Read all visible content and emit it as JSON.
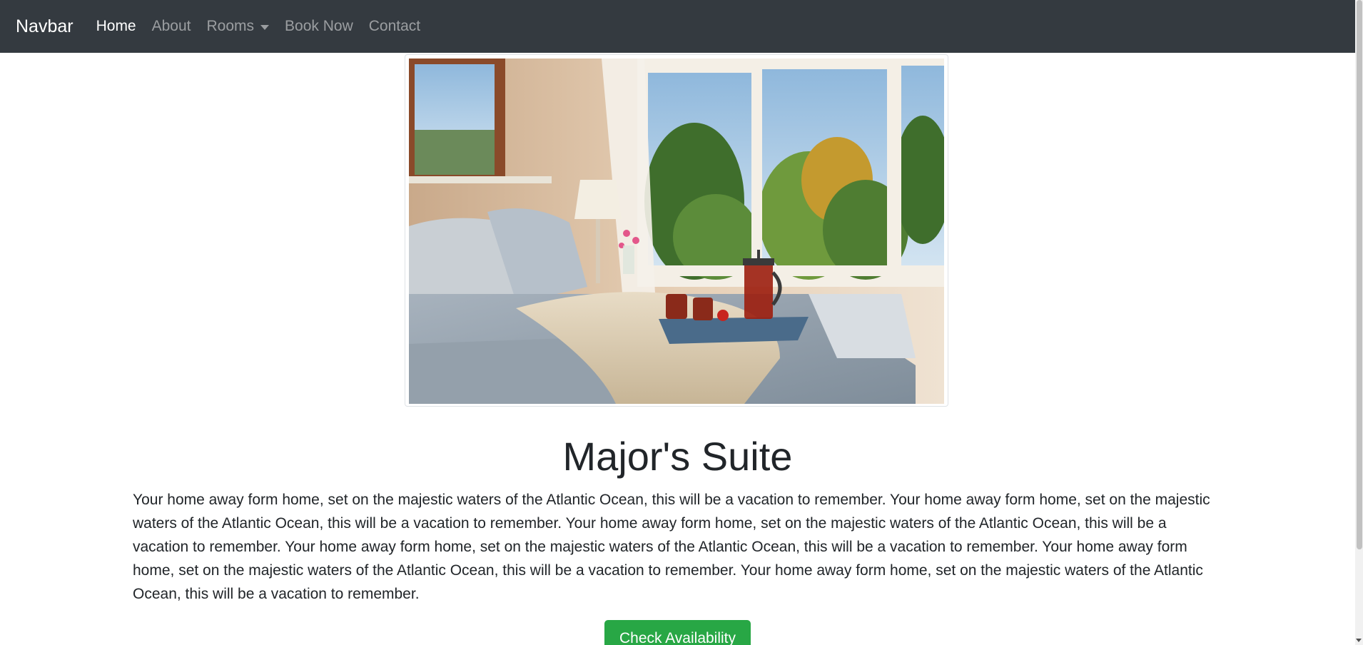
{
  "navbar": {
    "brand": "Navbar",
    "links": [
      {
        "label": "Home",
        "active": true
      },
      {
        "label": "About",
        "active": false
      },
      {
        "label": "Rooms",
        "active": false,
        "dropdown": true
      },
      {
        "label": "Book Now",
        "active": false
      },
      {
        "label": "Contact",
        "active": false
      }
    ]
  },
  "hero": {
    "image_icon": "bedroom-photo"
  },
  "room": {
    "title": "Major's Suite",
    "description": "Your home away form home, set on the majestic waters of the Atlantic Ocean, this will be a vacation to remember. Your home away form home, set on the majestic waters of the Atlantic Ocean, this will be a vacation to remember. Your home away form home, set on the majestic waters of the Atlantic Ocean, this will be a vacation to remember. Your home away form home, set on the majestic waters of the Atlantic Ocean, this will be a vacation to remember. Your home away form home, set on the majestic waters of the Atlantic Ocean, this will be a vacation to remember. Your home away form home, set on the majestic waters of the Atlantic Ocean, this will be a vacation to remember.",
    "button_label": "Check Availability"
  },
  "colors": {
    "navbar_bg": "#343a40",
    "button_green": "#28a745",
    "text": "#212529"
  }
}
